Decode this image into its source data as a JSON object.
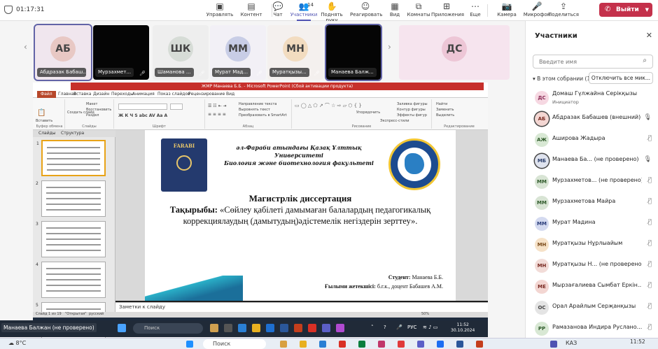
{
  "toolbar": {
    "timer": "01:17:31",
    "buttons": [
      {
        "label": "Управлять",
        "icon": "share-tray-icon"
      },
      {
        "label": "Контент",
        "icon": "share-screen-icon"
      },
      {
        "label": "Чат",
        "icon": "chat-icon"
      },
      {
        "label": "Участники",
        "icon": "people-icon",
        "badge": "14",
        "active": true
      },
      {
        "label": "Поднять руку",
        "icon": "raise-hand-icon"
      },
      {
        "label": "Реагировать",
        "icon": "react-icon"
      },
      {
        "label": "Вид",
        "icon": "view-icon"
      },
      {
        "label": "Комнаты",
        "icon": "rooms-icon"
      },
      {
        "label": "Приложения",
        "icon": "apps-icon"
      },
      {
        "label": "Еще",
        "icon": "more-icon"
      },
      {
        "label": "Камера",
        "icon": "camera-off-icon"
      },
      {
        "label": "Микрофон",
        "icon": "mic-off-icon"
      },
      {
        "label": "Поделиться",
        "icon": "share-icon"
      }
    ],
    "leave_label": "Выйти"
  },
  "strip": {
    "tiles": [
      {
        "initials": "АБ",
        "name": "Абдразак Бабаш...",
        "bg": "#f0e6ee",
        "avbg": "#e8c8c4",
        "selected": true
      },
      {
        "initials": "",
        "name": "Мурзахмет...",
        "bg": "#050505",
        "avbg": "",
        "mic": true
      },
      {
        "initials": "ШК",
        "name": "Шаманова ...",
        "bg": "#eeeeee",
        "avbg": "#d6dcd6",
        "mic": true
      },
      {
        "initials": "ММ",
        "name": "Мурат Мад...",
        "bg": "#f2f0f6",
        "avbg": "#c8cde6",
        "mic": true
      },
      {
        "initials": "МН",
        "name": "Муратқызы...",
        "bg": "#f4f0ee",
        "avbg": "#f2dcc0",
        "mic": true
      },
      {
        "initials": "",
        "name": "Манаева Балж...",
        "bg": "#050505",
        "avbg": "",
        "selected": true
      },
      {
        "initials": "ДС",
        "name": "",
        "bg": "#f6e4ee",
        "avbg": "#edc6d6"
      }
    ]
  },
  "ppt": {
    "title_bar": "ЖМР Манаева Б.Б. - Microsoft PowerPoint (Сбой активации продукта)",
    "menu": [
      "Файл",
      "Главная",
      "Вставка",
      "Дизайн",
      "Переходы",
      "Анимация",
      "Показ слайдов",
      "Рецензирование",
      "Вид"
    ],
    "ribbon_groups": [
      "Буфер обмена",
      "Слайды",
      "Шрифт",
      "Абзац",
      "Рисование",
      "Редактирование"
    ],
    "ribbon_items": [
      "Вставить",
      "Создать слайд",
      "Макет",
      "Восстановить",
      "Раздел",
      "Направление текста",
      "Выровнять текст",
      "Преобразовать в SmartArt",
      "Упорядочить",
      "Экспресс-стили",
      "Заливка фигуры",
      "Контур фигуры",
      "Эффекты фигур",
      "Найти",
      "Заменить",
      "Выделить"
    ],
    "panel_tabs": [
      "Слайды",
      "Структура"
    ],
    "slide": {
      "uni_line1": "әл-Фараби атындағы Қазақ Ұлттық Университеті",
      "uni_line2": "Биология және биотехнология факультеті",
      "logo_left_text": "FARABI",
      "heading": "Магистрлік диссертация",
      "topic_label": "Тақырыбы:",
      "topic_text": "«Сөйлеу қабілеті дамымаған балалардың педагогикалық коррекциялаудың (дамытудың)әдістемелік негіздерін зерттеу».",
      "student_label": "Студент:",
      "student_name": "Манаева Б.Б.",
      "supervisor_label": "Ғылыми жетекшісі:",
      "supervisor_name": "б.г.к., доцент Бабашев А.М."
    },
    "notes_placeholder": "Заметки к слайду",
    "status_left": "Слайд 1 из 19",
    "status_theme": "\"Открытая\"",
    "status_lang": "русский",
    "zoom": "50%"
  },
  "overlay_taskbar": {
    "presenter_name": "Манаева Балжан (не проверено)",
    "search": "Поиск",
    "lang": "РУС",
    "time": "11:52",
    "date": "30.10.2024"
  },
  "panel": {
    "title": "Участники",
    "search_placeholder": "Введите имя",
    "in_meeting": "В этом собрании (14)",
    "mute_all": "Отключить все мик...",
    "participants": [
      {
        "initials": "ДС",
        "name": "Домаш Гүлжайна Серікқызы",
        "role": "Инициатор",
        "avbg": "#f6d8e2",
        "color": "#8a2a55",
        "mic": "none"
      },
      {
        "initials": "АБ",
        "name": "Абдразак Бабашев (внешний)",
        "role": "",
        "avbg": "#f3d6d2",
        "color": "#7a2a22",
        "mic": "on",
        "ring": true
      },
      {
        "initials": "АЖ",
        "name": "Аширова Жадыра",
        "role": "",
        "avbg": "#d8e8d4",
        "color": "#2f5a2a",
        "mic": "off"
      },
      {
        "initials": "МБ",
        "name": "Манаева Ба...  (не проверено)",
        "role": "",
        "avbg": "#dfe3ee",
        "color": "#2a3d6a",
        "mic": "on",
        "ring": true
      },
      {
        "initials": "ММ",
        "name": "Мурзахметов... (не проверено)",
        "role": "",
        "avbg": "#d8e4d4",
        "color": "#2f5a2a",
        "mic": "off"
      },
      {
        "initials": "ММ",
        "name": "Мурзахметова Майра",
        "role": "",
        "avbg": "#d8e4d4",
        "color": "#2f5a2a",
        "mic": "off"
      },
      {
        "initials": "ММ",
        "name": "Мурат Мадина",
        "role": "",
        "avbg": "#d4daf0",
        "color": "#2a3d7a",
        "mic": "off"
      },
      {
        "initials": "МН",
        "name": "Муратқызы Нұрлыайым",
        "role": "",
        "avbg": "#f6e2c8",
        "color": "#7a4a1a",
        "mic": "off"
      },
      {
        "initials": "МН",
        "name": "Муратқызы Н... (не проверено)",
        "role": "",
        "avbg": "#f2dcd8",
        "color": "#7a2a22",
        "mic": "off"
      },
      {
        "initials": "МЕ",
        "name": "Мырзағалиева Сымбат Еркін...",
        "role": "",
        "avbg": "#f3d6d2",
        "color": "#7a2a22",
        "mic": "off"
      },
      {
        "initials": "ОС",
        "name": "Орал Арайлым Серҗанқызы",
        "role": "",
        "avbg": "#e4e4e4",
        "color": "#444444",
        "mic": "off"
      },
      {
        "initials": "РР",
        "name": "Рамазанова Индира Руслано...",
        "role": "",
        "avbg": "#d8e8d4",
        "color": "#2f5a2a",
        "mic": "off"
      }
    ]
  },
  "win_taskbar": {
    "weather": "8°C",
    "search": "Поиск",
    "lang": "КАЗ",
    "time": "11:52"
  },
  "colors": {
    "teams_accent": "#4f52b2",
    "leave_red": "#c4314b",
    "ppt_red": "#c6302b"
  }
}
